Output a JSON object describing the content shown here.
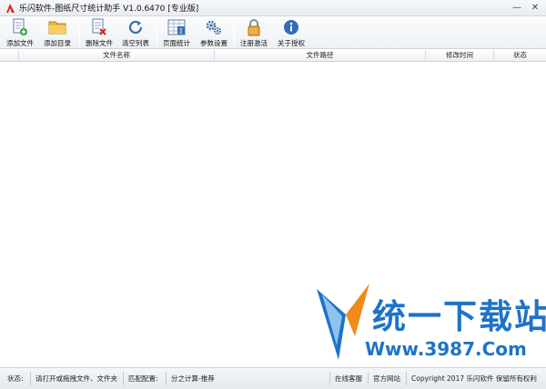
{
  "window": {
    "title": "乐闪软件-图纸尺寸统计助手 V1.0.6470 [专业版]",
    "controls": {
      "minimize": "—",
      "close": "✕"
    }
  },
  "toolbar": {
    "items": [
      {
        "label": "添加文件",
        "icon": "add-file-icon"
      },
      {
        "label": "添加目录",
        "icon": "folder-icon"
      },
      {
        "label": "删除文件",
        "icon": "delete-file-icon"
      },
      {
        "label": "清空列表",
        "icon": "refresh-icon"
      },
      {
        "label": "页面统计",
        "icon": "sum-table-icon"
      },
      {
        "label": "参数设置",
        "icon": "gears-icon"
      },
      {
        "label": "注册激活",
        "icon": "lock-icon"
      },
      {
        "label": "关于授权",
        "icon": "info-icon"
      }
    ]
  },
  "table": {
    "columns": [
      "文件名称",
      "文件路径",
      "修改时间",
      "状态"
    ],
    "rows": []
  },
  "watermark": {
    "text": "统一下载站",
    "url": "Www.3987.Com"
  },
  "statusbar": {
    "status_label": "状态:",
    "status_message": "请打开或拖拽文件、文件夹",
    "match_label": "匹配配置:",
    "calc_mode": "分之计算-推荐",
    "online_service": "在线客服",
    "official_site": "官方网站",
    "copyright": "Copyright 2017 乐闪软件 保留所有权利"
  },
  "colors": {
    "accent": "#1e73c8",
    "watermark_orange": "#f08a1c"
  }
}
